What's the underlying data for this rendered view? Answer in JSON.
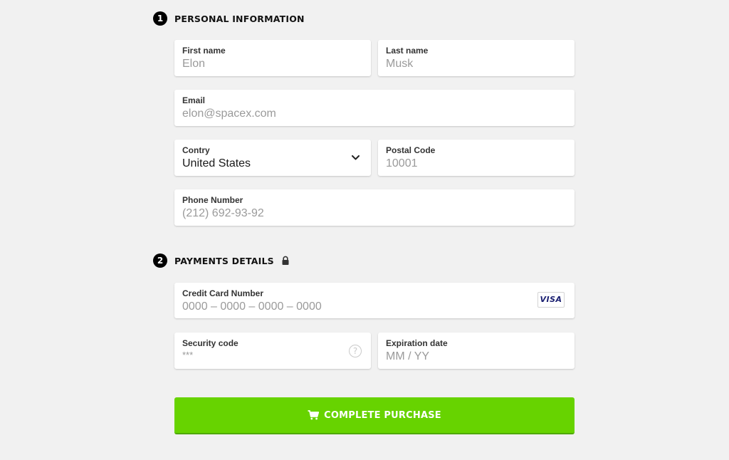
{
  "personal": {
    "step": "1",
    "title": "PERSONAL INFORMATION",
    "first_name": {
      "label": "First name",
      "value": "Elon"
    },
    "last_name": {
      "label": "Last name",
      "value": "Musk"
    },
    "email": {
      "label": "Email",
      "value": "elon@spacex.com"
    },
    "country": {
      "label": "Contry",
      "value": "United States"
    },
    "postal": {
      "label": "Postal Code",
      "value": "10001"
    },
    "phone": {
      "label": "Phone Number",
      "value": "(212) 692-93-92"
    }
  },
  "payment": {
    "step": "2",
    "title": "PAYMENTS DETAILS",
    "card": {
      "label": "Credit Card Number",
      "placeholder": "0000 – 0000 – 0000 – 0000",
      "brand": "VISA"
    },
    "security": {
      "label": "Security code",
      "placeholder": "***",
      "help": "?"
    },
    "expiration": {
      "label": "Expiration date",
      "placeholder": "MM / YY"
    }
  },
  "purchase_button": {
    "label": "COMPLETE PURCHASE"
  },
  "icons": {
    "lock": "lock-icon",
    "chevron": "chevron-down-icon",
    "help": "question-circle-icon",
    "cart": "cart-icon"
  },
  "colors": {
    "accent": "#67d300",
    "background": "#f1f1f1",
    "placeholder": "#9a9a9a"
  }
}
